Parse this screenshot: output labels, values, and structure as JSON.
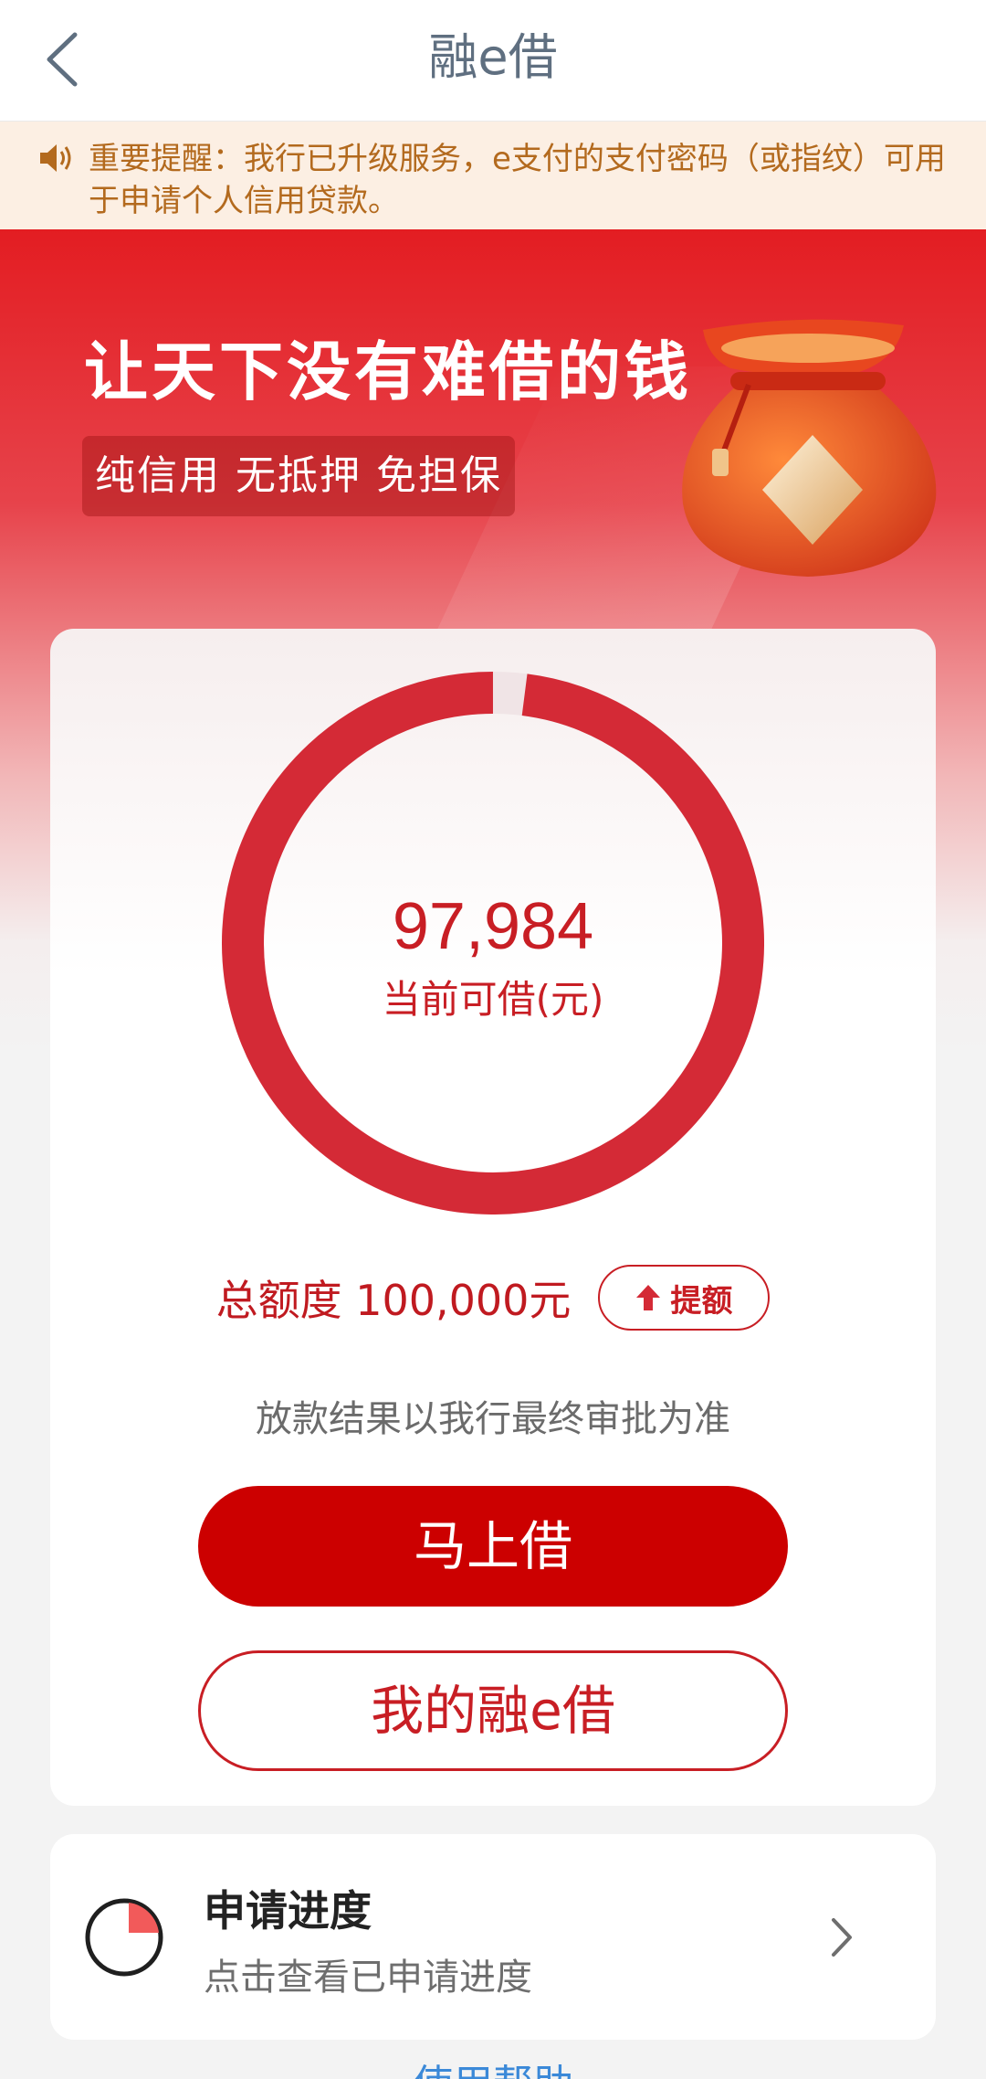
{
  "header": {
    "title": "融e借",
    "back_icon": "chevron-left-icon"
  },
  "notice": {
    "icon": "speaker-icon",
    "text": "重要提醒：我行已升级服务，e支付的支付密码（或指纹）可用于申请个人信用贷款。"
  },
  "hero": {
    "slogan": "让天下没有难借的钱",
    "tagline": "纯信用 无抵押 免担保",
    "illustration": "money-bag-icon"
  },
  "credit": {
    "available_amount": "97,984",
    "available_label": "当前可借(元)",
    "total_label": "总额度 100,000元",
    "raise_label": "提额",
    "used_fraction": 0.02016,
    "note": "放款结果以我行最终审批为准",
    "borrow_label": "马上借",
    "my_loan_label": "我的融e借"
  },
  "progress": {
    "title": "申请进度",
    "subtitle": "点击查看已申请进度"
  },
  "help": {
    "label": "使用帮助"
  },
  "colors": {
    "brand_red": "#cc0000",
    "ring_red": "#d42a36",
    "notice_text": "#b36a1e"
  }
}
